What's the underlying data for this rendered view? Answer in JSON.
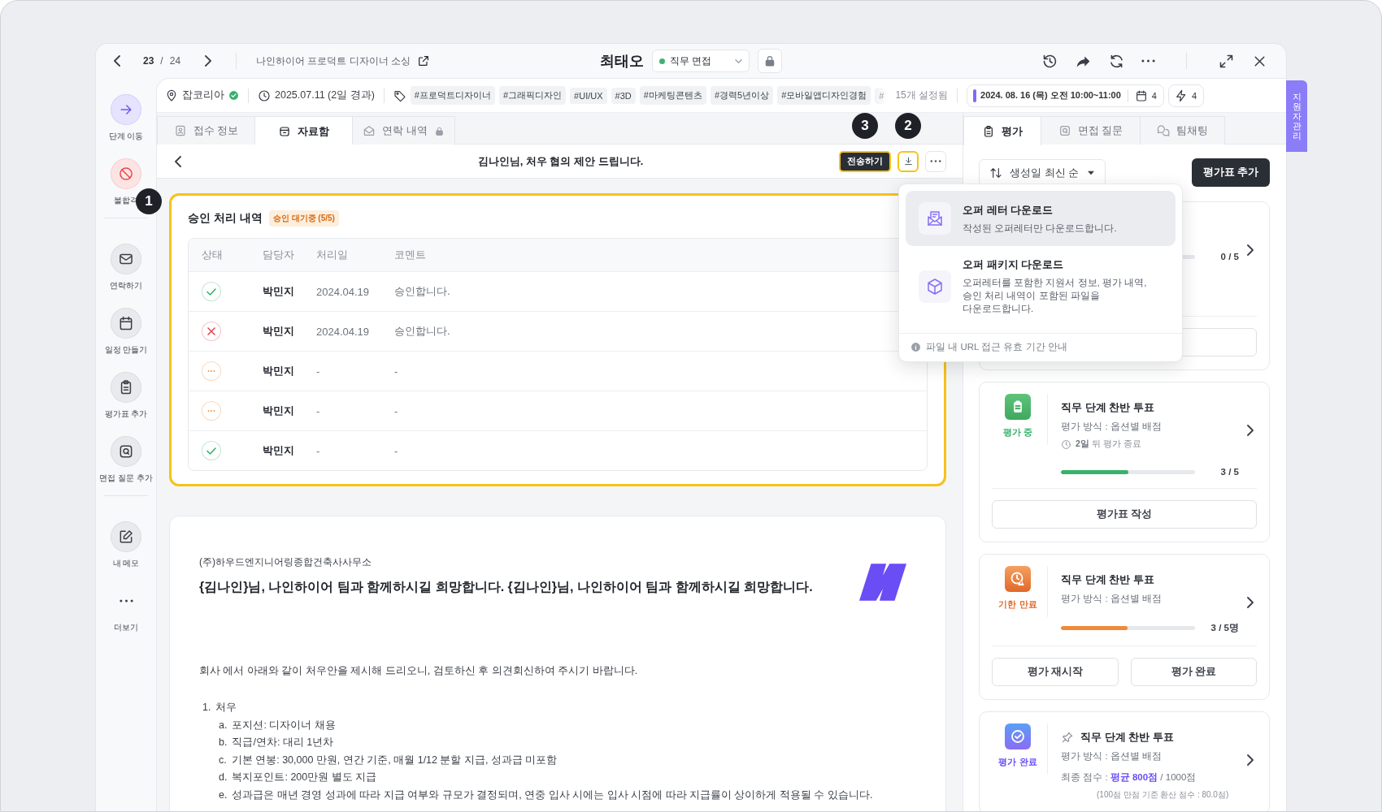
{
  "header": {
    "index": "23",
    "separator": "/",
    "total": "24",
    "job_title": "나인하이어 프로덕트 디자이너 소싱",
    "candidate_name": "최태오",
    "stage": "직무 면접"
  },
  "side_tab": {
    "label": "지원자 관리"
  },
  "sidebar": {
    "groups": [
      [
        {
          "label": "단계 이동",
          "kind": "primary"
        },
        {
          "label": "불합격",
          "kind": "danger"
        }
      ],
      [
        {
          "label": "연락하기",
          "kind": "normal"
        },
        {
          "label": "일정 만들기",
          "kind": "normal"
        },
        {
          "label": "평가표 추가",
          "kind": "normal"
        },
        {
          "label": "면접 질문 추가",
          "kind": "normal"
        }
      ],
      [
        {
          "label": "내 메모",
          "kind": "normal"
        },
        {
          "label": "더보기",
          "kind": "plain"
        }
      ]
    ]
  },
  "info_bar": {
    "source": "잡코리아",
    "source_verified": true,
    "applied": "2025.07.11 (2일 경과)",
    "tags": [
      "#프로덕트디자이너",
      "#그래픽디자인",
      "#UI/UX",
      "#3D",
      "#마케팅콘텐츠",
      "#경력5년이상",
      "#모바일앱디자인경험"
    ],
    "tag_overflow": "#",
    "tag_count": "15개 설정됨",
    "schedule": "2024. 08. 16 (목) 오전 10:00~11:00",
    "schedule_count": "4",
    "action_count": "4"
  },
  "left_tabs": [
    {
      "label": "접수 정보",
      "selected": false,
      "locked": false
    },
    {
      "label": "자료함",
      "selected": true,
      "locked": false
    },
    {
      "label": "연락 내역",
      "selected": false,
      "locked": true
    }
  ],
  "document_header": {
    "title": "김나인님, 처우 협의 제안 드립니다.",
    "send_button": {
      "label": "전송하기",
      "highlighted": true,
      "callout": "3"
    },
    "download_button": {
      "highlighted": true,
      "callout": "2"
    }
  },
  "download_menu": {
    "items": [
      {
        "title": "오퍼 레터 다운로드",
        "description": "작성된 오퍼레터만 다운로드합니다.",
        "selected": true
      },
      {
        "title": "오퍼 패키지 다운로드",
        "description": "오퍼레터를 포함한 지원서 정보, 평가 내역, 승인 처리 내역이 포함된 파일을 다운로드합니다.",
        "selected": false
      }
    ],
    "footer": "파일 내 URL 접근 유효 기간 안내"
  },
  "approval": {
    "title": "승인 처리 내역",
    "badge": "승인 대기중 (5/5)",
    "highlighted": true,
    "callout": "1",
    "columns": [
      "상태",
      "담당자",
      "처리일",
      "코멘트"
    ],
    "rows": [
      {
        "kind": "approved",
        "assignee": "박민지",
        "date": "2024.04.19",
        "comment": "승인합니다."
      },
      {
        "kind": "rejected",
        "assignee": "박민지",
        "date": "2024.04.19",
        "comment": "승인합니다."
      },
      {
        "kind": "pending",
        "assignee": "박민지",
        "date": "-",
        "comment": "-"
      },
      {
        "kind": "pending",
        "assignee": "박민지",
        "date": "-",
        "comment": "-"
      },
      {
        "kind": "approved",
        "assignee": "박민지",
        "date": "-",
        "comment": "-"
      }
    ]
  },
  "letter": {
    "company": "(주)하우드엔지니어링종합건축사사무소",
    "headline": "{김나인}님, 나인하이어 팀과 함께하시길 희망합니다. {김나인}님, 나인하이어 팀과 함께하시길 희망합니다.",
    "intro": "회사 에서 아래와 같이 처우안을 제시해 드리오니, 검토하신 후 의견회신하여 주시기 바랍니다.",
    "sections": [
      {
        "marker": "1.",
        "title": "처우",
        "items": [
          {
            "marker": "a.",
            "text": "포지션: 디자이너 채용"
          },
          {
            "marker": "b.",
            "text": "직급/연차: 대리 1년차"
          },
          {
            "marker": "c.",
            "text": "기본 연봉: 30,000 만원, 연간 기준, 매월 1/12 분할 지급, 성과급 미포함"
          },
          {
            "marker": "d.",
            "text": "복지포인트: 200만원 별도 지급"
          },
          {
            "marker": "e.",
            "text": "성과급은 매년 경영 성과에 따라 지급 여부와 규모가 결정되며, 연중 입사 시에는 입사 시점에 따라 지급률이 상이하게 적용될 수 있습니다."
          }
        ]
      }
    ]
  },
  "right_tabs": [
    {
      "label": "평가",
      "selected": true
    },
    {
      "label": "면접 질문",
      "selected": false
    },
    {
      "label": "팀채팅",
      "selected": false
    }
  ],
  "sort": {
    "label": "생성일 최신 순"
  },
  "add_button": "평가표 추가",
  "cards": [
    {
      "count": "0 / 5",
      "level": 0,
      "has_button": true
    },
    {
      "kind": "in_progress",
      "status": "평가 중",
      "title": "직무 단계 찬반 투표",
      "method": "평가 방식 : 옵션별 배점",
      "deadline": "**2일** 뒤 평가 종료",
      "count": "3 / 5",
      "level": 0.5,
      "buttons": [
        "평가표 작성"
      ]
    },
    {
      "kind": "expired",
      "status": "기한 만료",
      "title": "직무 단계 찬반 투표",
      "method": "평가 방식 : 옵션별 배점",
      "count": "3 / 5명",
      "level": 0.5,
      "buttons": [
        "평가 재시작",
        "평가 완료"
      ]
    },
    {
      "kind": "done",
      "status": "평가 완료",
      "pinned": true,
      "title": "직무 단계 찬반 투표",
      "method": "평가 방식 : 옵션별 배점",
      "score": "최종 점수 : **평균 800점** / 1000점",
      "score_note": "(100점 만점 기준 환산 점수 : 80.0점)"
    }
  ]
}
